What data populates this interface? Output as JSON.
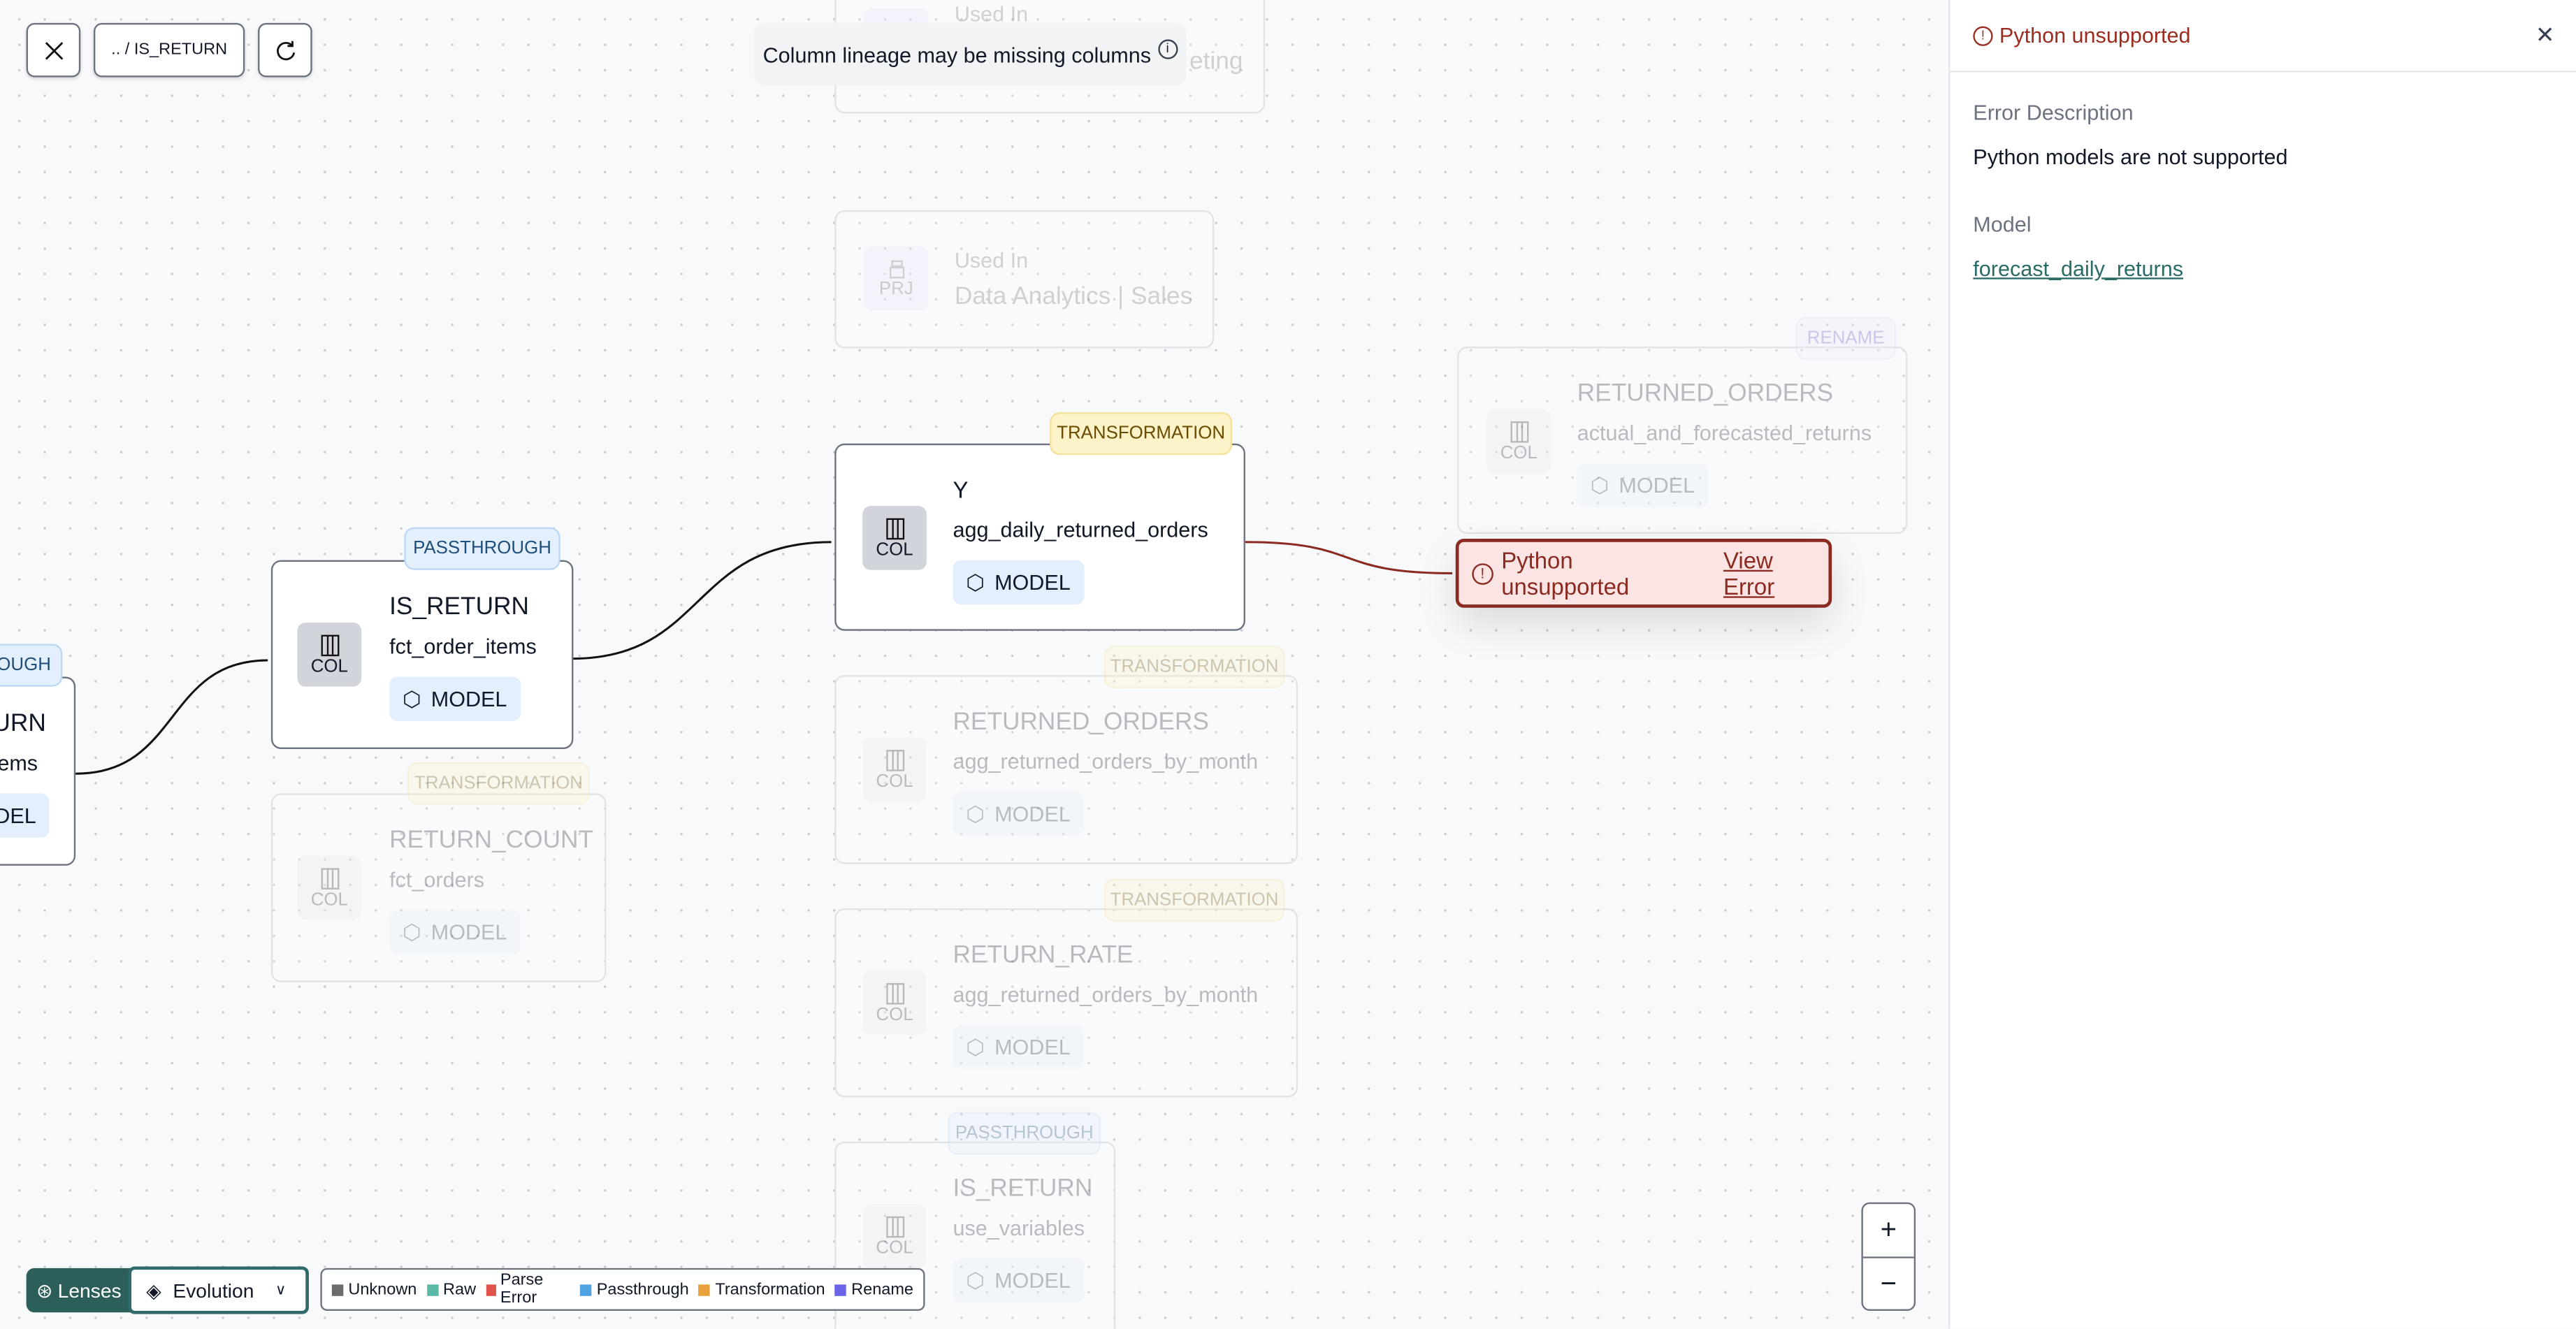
{
  "toolbar": {
    "close_icon": "x-icon",
    "breadcrumb": ".. / IS_RETURN",
    "refresh_icon": "refresh-icon"
  },
  "notice": {
    "text": "Column lineage may be missing columns",
    "icon": "info-icon"
  },
  "nodes": {
    "top_faded": {
      "label": "Used In",
      "name_fragment": "eting"
    },
    "project": {
      "type": "PRJ",
      "label": "Used In",
      "name": "Data Analytics | Sales"
    },
    "rename_node": {
      "badge": "RENAME",
      "type": "COL",
      "title": "RETURNED_ORDERS",
      "model": "actual_and_forecasted_returns",
      "chip": "MODEL"
    },
    "y_node": {
      "badge": "TRANSFORMATION",
      "type": "COL",
      "title": "Y",
      "model": "agg_daily_returned_orders",
      "chip": "MODEL"
    },
    "is_return": {
      "badge": "PASSTHROUGH",
      "type": "COL",
      "title": "IS_RETURN",
      "model": "fct_order_items",
      "chip": "MODEL"
    },
    "left_partial": {
      "badge": "OUGH",
      "title": "URN",
      "model": "ems",
      "chip": "DEL"
    },
    "return_count": {
      "badge": "TRANSFORMATION",
      "type": "COL",
      "title": "RETURN_COUNT",
      "model": "fct_orders",
      "chip": "MODEL"
    },
    "returned_orders": {
      "badge": "TRANSFORMATION",
      "type": "COL",
      "title": "RETURNED_ORDERS",
      "model": "agg_returned_orders_by_month",
      "chip": "MODEL"
    },
    "return_rate": {
      "badge": "TRANSFORMATION",
      "type": "COL",
      "title": "RETURN_RATE",
      "model": "agg_returned_orders_by_month",
      "chip": "MODEL"
    },
    "is_return_vars": {
      "badge": "PASSTHROUGH",
      "type": "COL",
      "title": "IS_RETURN",
      "model": "use_variables",
      "chip": "MODEL"
    }
  },
  "error_node": {
    "text": "Python unsupported",
    "link": "View Error"
  },
  "panel": {
    "title": "Python unsupported",
    "error_label": "Error Description",
    "error_value": "Python models are not supported",
    "model_label": "Model",
    "model_value": "forecast_daily_returns"
  },
  "zoom": {
    "in": "+",
    "out": "−"
  },
  "bottom": {
    "lenses": "Lenses",
    "lens_selected": "Evolution",
    "legend": [
      {
        "label": "Unknown",
        "color": "#6b6b6b"
      },
      {
        "label": "Raw",
        "color": "#5bb8a6"
      },
      {
        "label": "Parse Error",
        "color": "#e0534a"
      },
      {
        "label": "Passthrough",
        "color": "#4fa3e3"
      },
      {
        "label": "Transformation",
        "color": "#e9a23b"
      },
      {
        "label": "Rename",
        "color": "#6b63e8"
      }
    ]
  },
  "colors": {
    "error": "#8b2a20",
    "accent": "#2d5f5a",
    "link": "#2a6b66"
  }
}
